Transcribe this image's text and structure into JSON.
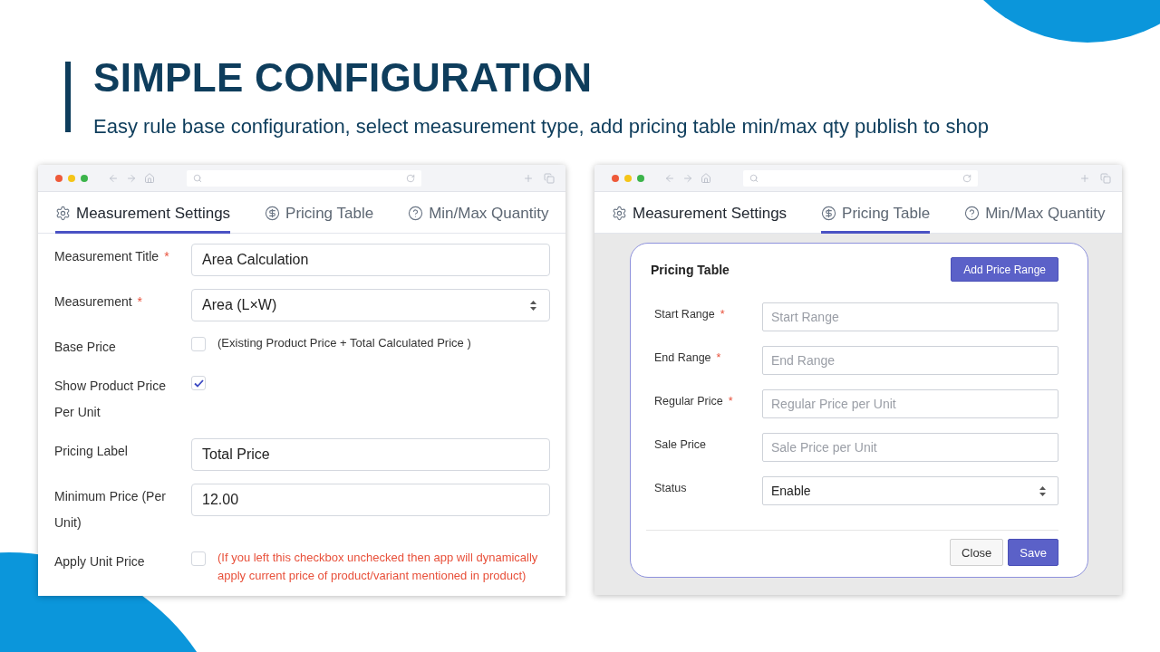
{
  "header": {
    "title": "SIMPLE CONFIGURATION",
    "subtitle": "Easy rule base configuration, select measurement type, add pricing table min/max qty publish to shop"
  },
  "left_window": {
    "tabs": [
      {
        "label": "Measurement Settings",
        "selected": true
      },
      {
        "label": "Pricing Table",
        "selected": false
      },
      {
        "label": "Min/Max Quantity",
        "selected": false
      }
    ],
    "form": [
      {
        "kind": "text",
        "label": "Measurement Title",
        "required_mark": "*",
        "value": "Area Calculation"
      },
      {
        "kind": "select",
        "label": "Measurement",
        "required_mark": "*",
        "value": "Area (L×W)"
      },
      {
        "kind": "checkbox",
        "label": "Base Price",
        "checked": false,
        "note": "(Existing Product Price + Total Calculated Price )",
        "warning": false
      },
      {
        "kind": "checkbox",
        "label": "Show Product Price Per Unit",
        "checked": true
      },
      {
        "kind": "text",
        "label": "Pricing Label",
        "value": "Total Price"
      },
      {
        "kind": "text",
        "label": "Minimum Price (Per Unit)",
        "value": "12.00"
      },
      {
        "kind": "checkbox",
        "label": "Apply Unit Price",
        "checked": false,
        "note": "(If you left this checkbox unchecked then app will dynamically apply current price of product/variant mentioned in product)",
        "warning": true
      }
    ]
  },
  "right_window": {
    "tabs": [
      {
        "label": "Measurement Settings",
        "selected": false
      },
      {
        "label": "Pricing Table",
        "selected": true
      },
      {
        "label": "Min/Max Quantity",
        "selected": false
      }
    ],
    "dialog": {
      "title": "Pricing Table",
      "action": "Add Price Range",
      "fields": [
        {
          "kind": "text",
          "label": "Start Range",
          "required_mark": "*",
          "placeholder": "Start Range"
        },
        {
          "kind": "text",
          "label": "End Range",
          "required_mark": "*",
          "placeholder": "End Range"
        },
        {
          "kind": "text",
          "label": "Regular Price",
          "required_mark": "*",
          "placeholder": "Regular Price per Unit"
        },
        {
          "kind": "text",
          "label": "Sale Price",
          "placeholder": "Sale Price per Unit"
        },
        {
          "kind": "select",
          "label": "Status",
          "value": "Enable"
        }
      ],
      "buttons": [
        {
          "label": "Close",
          "kind": "secondary"
        },
        {
          "label": "Save",
          "kind": "primary"
        }
      ]
    }
  }
}
